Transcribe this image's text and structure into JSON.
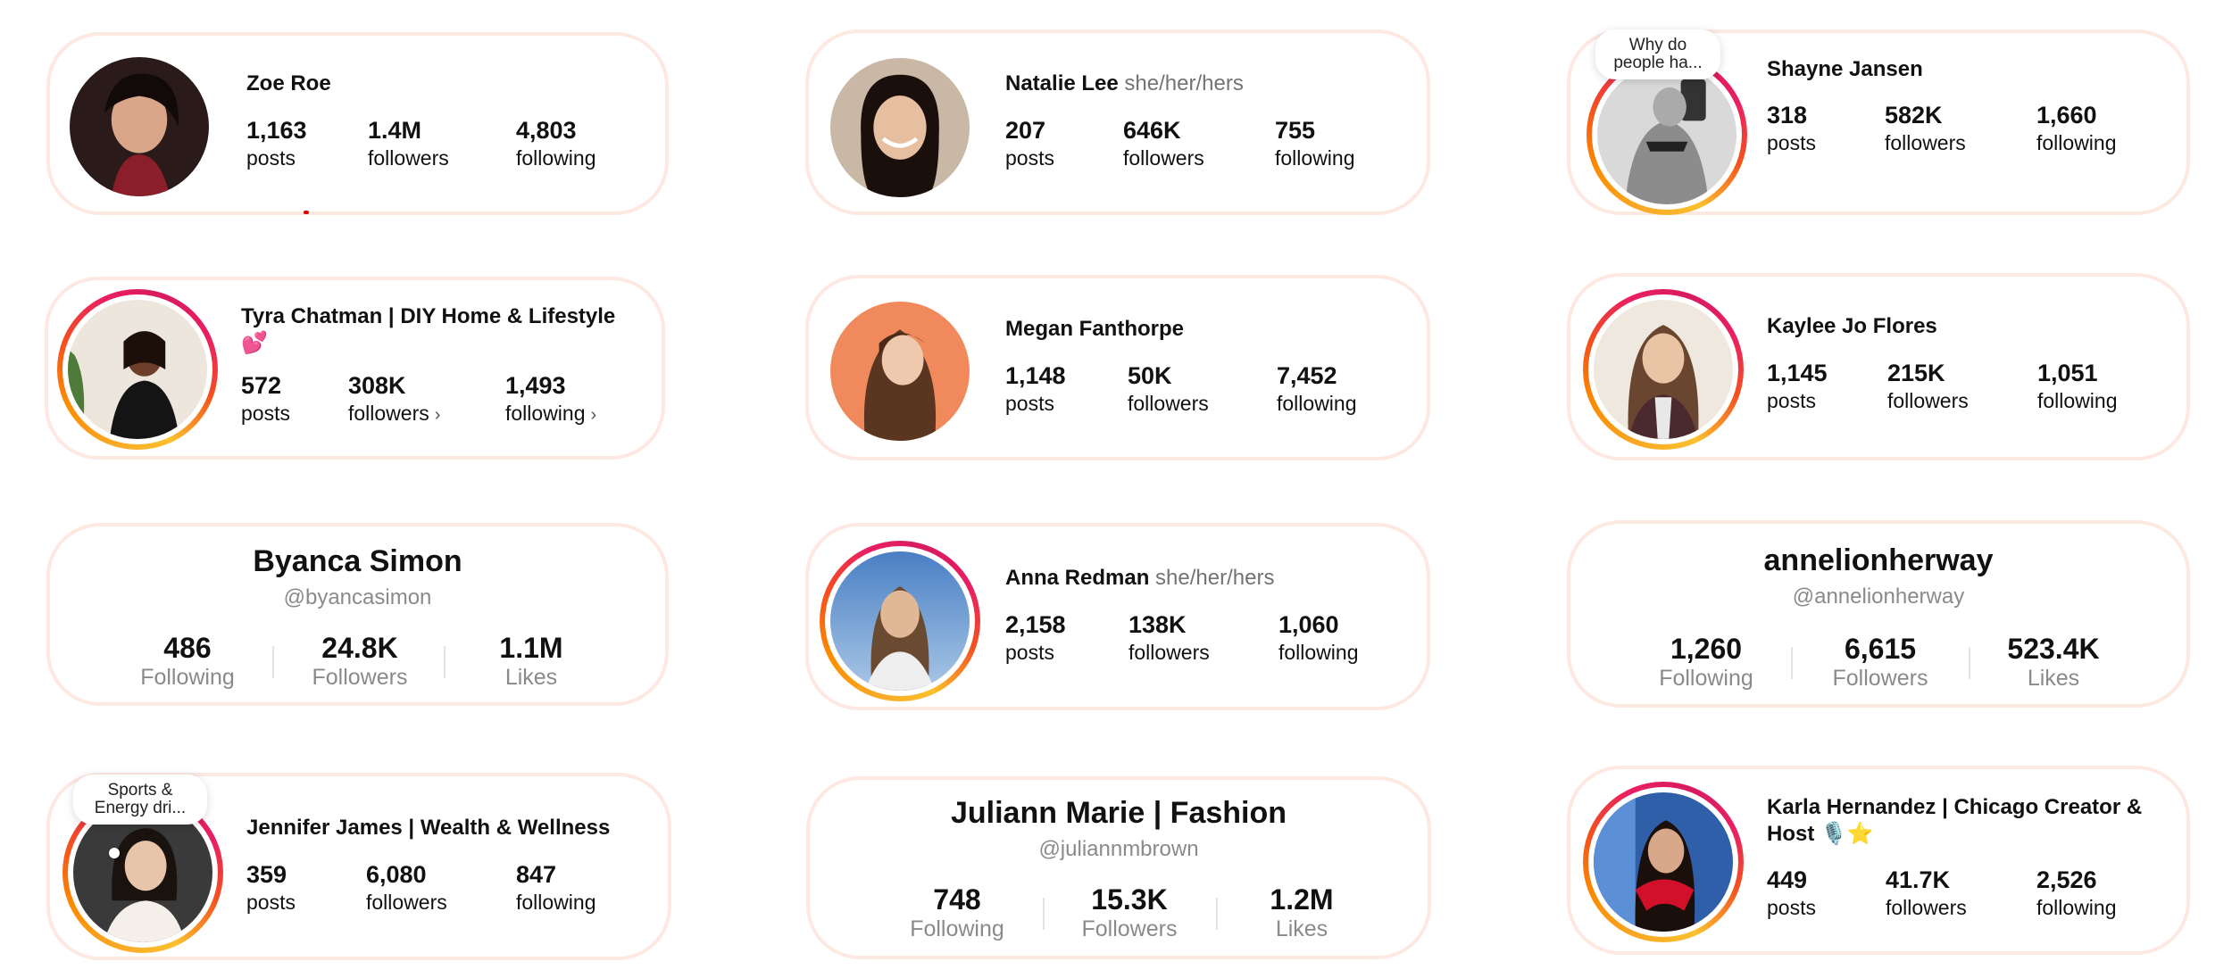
{
  "profiles": [
    {
      "name": "Zoe Roe",
      "stats": [
        {
          "value": "1,163",
          "label": "posts"
        },
        {
          "value": "1.4M",
          "label": "followers"
        },
        {
          "value": "4,803",
          "label": "following"
        }
      ]
    },
    {
      "name": "Natalie Lee",
      "pronouns": "she/her/hers",
      "stats": [
        {
          "value": "207",
          "label": "posts"
        },
        {
          "value": "646K",
          "label": "followers"
        },
        {
          "value": "755",
          "label": "following"
        }
      ]
    },
    {
      "name": "Shayne Jansen",
      "note": "Why do people ha...",
      "stats": [
        {
          "value": "318",
          "label": "posts"
        },
        {
          "value": "582K",
          "label": "followers"
        },
        {
          "value": "1,660",
          "label": "following"
        }
      ]
    },
    {
      "name": "Tyra Chatman | DIY Home & Lifestyle 💕",
      "stats": [
        {
          "value": "572",
          "label": "posts"
        },
        {
          "value": "308K",
          "label": "followers"
        },
        {
          "value": "1,493",
          "label": "following"
        }
      ]
    },
    {
      "name": "Megan Fanthorpe",
      "stats": [
        {
          "value": "1,148",
          "label": "posts"
        },
        {
          "value": "50K",
          "label": "followers"
        },
        {
          "value": "7,452",
          "label": "following"
        }
      ]
    },
    {
      "name": "Kaylee Jo Flores",
      "stats": [
        {
          "value": "1,145",
          "label": "posts"
        },
        {
          "value": "215K",
          "label": "followers"
        },
        {
          "value": "1,051",
          "label": "following"
        }
      ]
    },
    {
      "name": "Byanca Simon",
      "handle": "@byancasimon",
      "stats": [
        {
          "value": "486",
          "label": "Following"
        },
        {
          "value": "24.8K",
          "label": "Followers"
        },
        {
          "value": "1.1M",
          "label": "Likes"
        }
      ]
    },
    {
      "name": "Anna Redman",
      "pronouns": "she/her/hers",
      "stats": [
        {
          "value": "2,158",
          "label": "posts"
        },
        {
          "value": "138K",
          "label": "followers"
        },
        {
          "value": "1,060",
          "label": "following"
        }
      ]
    },
    {
      "name": "annelionherway",
      "handle": "@annelionherway",
      "stats": [
        {
          "value": "1,260",
          "label": "Following"
        },
        {
          "value": "6,615",
          "label": "Followers"
        },
        {
          "value": "523.4K",
          "label": "Likes"
        }
      ]
    },
    {
      "name": "Jennifer James | Wealth & Wellness",
      "note": "Sports & Energy dri...",
      "stats": [
        {
          "value": "359",
          "label": "posts"
        },
        {
          "value": "6,080",
          "label": "followers"
        },
        {
          "value": "847",
          "label": "following"
        }
      ]
    },
    {
      "name": "Juliann Marie | Fashion",
      "handle": "@juliannmbrown",
      "stats": [
        {
          "value": "748",
          "label": "Following"
        },
        {
          "value": "15.3K",
          "label": "Followers"
        },
        {
          "value": "1.2M",
          "label": "Likes"
        }
      ]
    },
    {
      "name": "Karla Hernandez | Chicago Creator & Host 🎙️⭐",
      "stats": [
        {
          "value": "449",
          "label": "posts"
        },
        {
          "value": "41.7K",
          "label": "followers"
        },
        {
          "value": "2,526",
          "label": "following"
        }
      ]
    }
  ],
  "chevron": "›",
  "colors": {
    "card_border": "#fde8e2",
    "ring": "#e91e63",
    "muted": "#737373"
  }
}
